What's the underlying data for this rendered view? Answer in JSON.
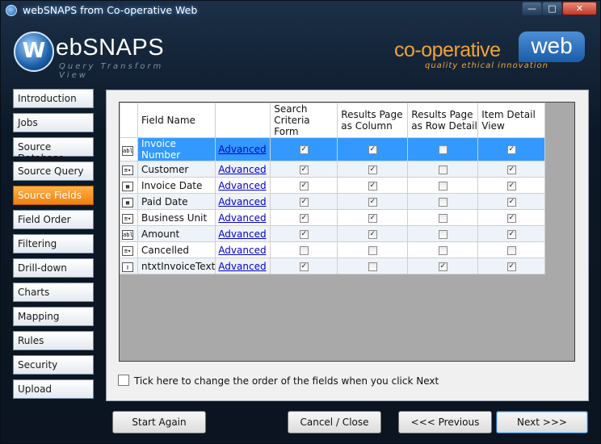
{
  "window": {
    "title": "webSNAPS from Co-operative Web",
    "min": "—",
    "max": "□",
    "close": "✕"
  },
  "brand": {
    "logo_letter": "W",
    "logo_text": "ebSNAPS",
    "tagline": "Query  Transform  View"
  },
  "partner": {
    "text": "co-operative",
    "web": "web",
    "tagline": "quality ethical innovation"
  },
  "nav": [
    {
      "label": "Introduction"
    },
    {
      "label": "Jobs"
    },
    {
      "label": "Source Database"
    },
    {
      "label": "Source Query"
    },
    {
      "label": "Source Fields",
      "active": true
    },
    {
      "label": "Field Order"
    },
    {
      "label": "Filtering"
    },
    {
      "label": "Drill-down"
    },
    {
      "label": "Charts"
    },
    {
      "label": "Mapping"
    },
    {
      "label": "Rules"
    },
    {
      "label": "Security"
    },
    {
      "label": "Upload"
    }
  ],
  "grid": {
    "headers": {
      "field_name": "Field Name",
      "search_1": "Search",
      "search_2": "Criteria Form",
      "rp_col_1": "Results Page",
      "rp_col_2": "as Column",
      "rp_row_1": "Results Page",
      "rp_row_2": "as Row Detail",
      "detail_1": "Item Detail",
      "detail_2": "View"
    },
    "rows": [
      {
        "type": "abl",
        "name": "Invoice Number",
        "link": "Advanced",
        "search": true,
        "column": true,
        "row": false,
        "detail": true,
        "selected": true
      },
      {
        "type": "combo",
        "name": "Customer",
        "link": "Advanced",
        "search": true,
        "column": true,
        "row": false,
        "detail": true
      },
      {
        "type": "date",
        "name": "Invoice Date",
        "link": "Advanced",
        "search": true,
        "column": true,
        "row": false,
        "detail": true
      },
      {
        "type": "date",
        "name": "Paid Date",
        "link": "Advanced",
        "search": true,
        "column": true,
        "row": false,
        "detail": true
      },
      {
        "type": "combo",
        "name": "Business Unit",
        "link": "Advanced",
        "search": true,
        "column": true,
        "row": false,
        "detail": true
      },
      {
        "type": "abl",
        "name": "Amount",
        "link": "Advanced",
        "search": true,
        "column": true,
        "row": false,
        "detail": true
      },
      {
        "type": "combo",
        "name": "Cancelled",
        "link": "Advanced",
        "search": false,
        "column": false,
        "row": false,
        "detail": false
      },
      {
        "type": "memo",
        "name": "ntxtInvoiceText",
        "link": "Advanced",
        "search": true,
        "column": false,
        "row": true,
        "detail": true
      }
    ]
  },
  "order_checkbox": {
    "label": "Tick here to change the order of the fields when you click Next",
    "checked": false
  },
  "buttons": {
    "start_again": "Start Again",
    "cancel_close": "Cancel / Close",
    "previous": "<<< Previous",
    "next": "Next >>>"
  },
  "colors": {
    "active_nav": "#f07f0c",
    "selection": "#3399ff",
    "link": "#0000cc"
  }
}
